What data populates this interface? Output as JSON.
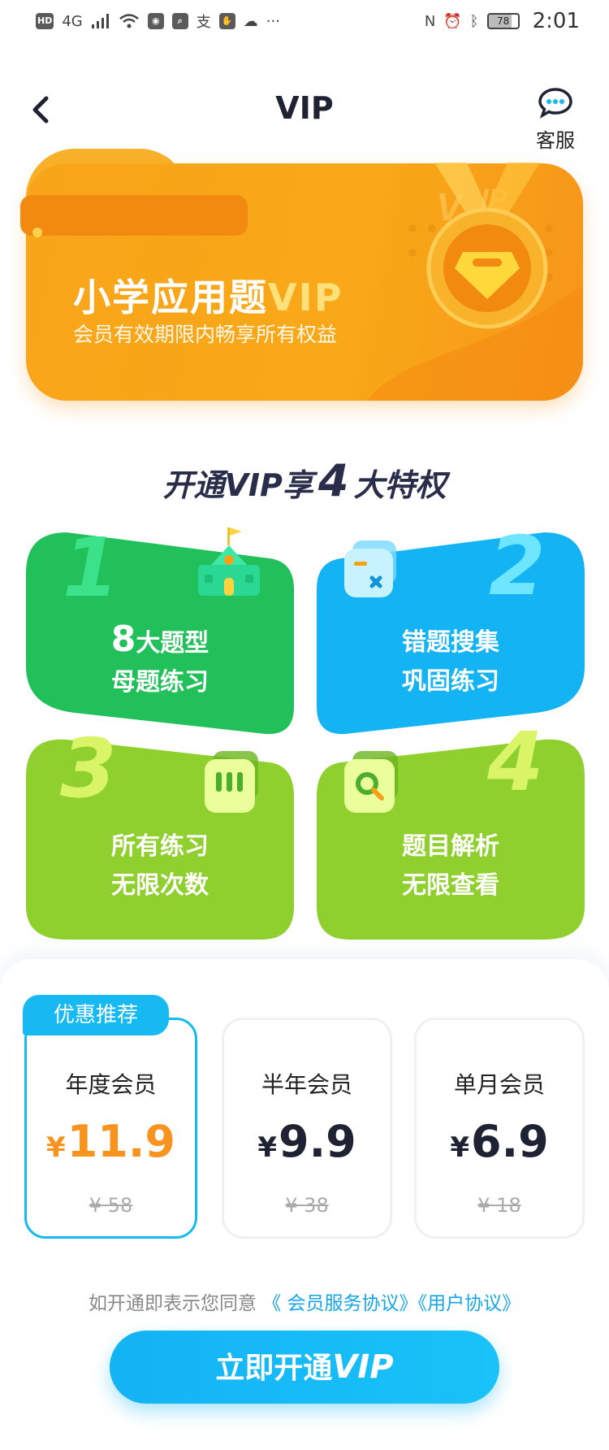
{
  "status_bar": {
    "left_chips": [
      "HD",
      "4G"
    ],
    "right_battery": "78",
    "time": "2:01"
  },
  "header": {
    "title": "VIP",
    "service_label": "客服",
    "back_icon": "chevron-left-icon",
    "service_icon": "chat-bubble-icon"
  },
  "banner": {
    "title": "小学应用题",
    "title_vip": "VIP",
    "subtitle": "会员有效期限内畅享所有权益",
    "colors": {
      "base": "#f9a51a",
      "dark": "#f28a10",
      "medal": "#ffd93b"
    }
  },
  "privileges": {
    "heading_prefix": "开通VIP享",
    "heading_num": "4",
    "heading_suffix": "大特权",
    "cards": [
      {
        "number": "1",
        "line1_big": "8",
        "line1": "大题型",
        "line2": "母题练习",
        "color": "#22c05a",
        "icon": "school-icon"
      },
      {
        "number": "2",
        "line1": "错题搜集",
        "line2": "巩固练习",
        "color": "#14b3f4",
        "icon": "error-note-icon"
      },
      {
        "number": "3",
        "line1": "所有练习",
        "line2": "无限次数",
        "color": "#8fcf2e",
        "icon": "practice-bars-icon"
      },
      {
        "number": "4",
        "line1": "题目解析",
        "line2": "无限查看",
        "color": "#8fcf2e",
        "icon": "search-icon"
      }
    ]
  },
  "plans": {
    "badge": "优惠推荐",
    "currency": "¥",
    "items": [
      {
        "name": "年度会员",
        "price": "11.9",
        "original": "¥ 58",
        "selected": true
      },
      {
        "name": "半年会员",
        "price": "9.9",
        "original": "¥ 38",
        "selected": false
      },
      {
        "name": "单月会员",
        "price": "6.9",
        "original": "¥ 18",
        "selected": false
      }
    ]
  },
  "agreement": {
    "prefix": "如开通即表示您同意",
    "link1": "《 会员服务协议》",
    "link2": "《用户协议》"
  },
  "cta": {
    "label": "立即开通",
    "label_vip": "VIP",
    "color": "#14b3f4"
  }
}
